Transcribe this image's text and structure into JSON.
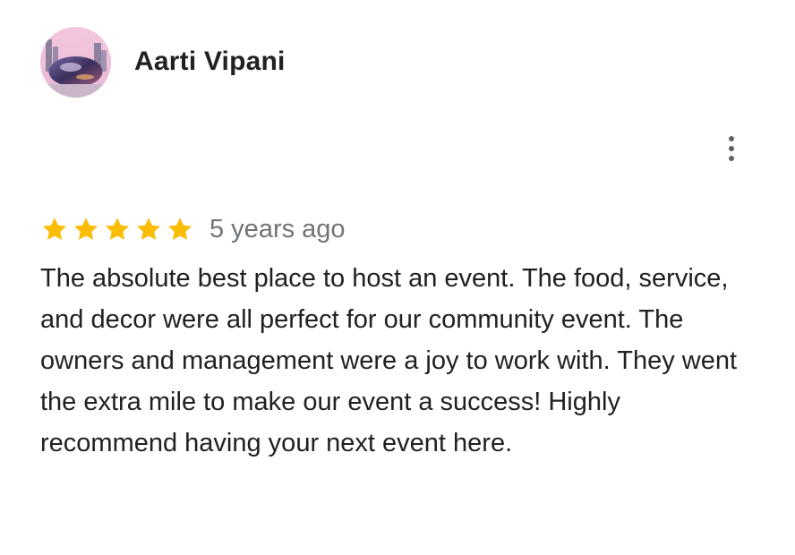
{
  "reviewer": {
    "name": "Aarti Vipani",
    "avatar_icon": "profile-photo-bean-sculpture"
  },
  "menu": {
    "icon": "more-vert-icon"
  },
  "review": {
    "rating": 5,
    "max_rating": 5,
    "time_ago": "5 years ago",
    "text": "The absolute best place to host an event. The food, service, and decor were all perfect for our community event. The owners and management were a joy to work with. They went the extra mile to make our event a success! Highly recommend having your next event here."
  },
  "colors": {
    "star": "#fbbc04",
    "star_empty": "#dadce0",
    "text": "#202124",
    "secondary_text": "#70757a",
    "icon": "#5f6368"
  }
}
